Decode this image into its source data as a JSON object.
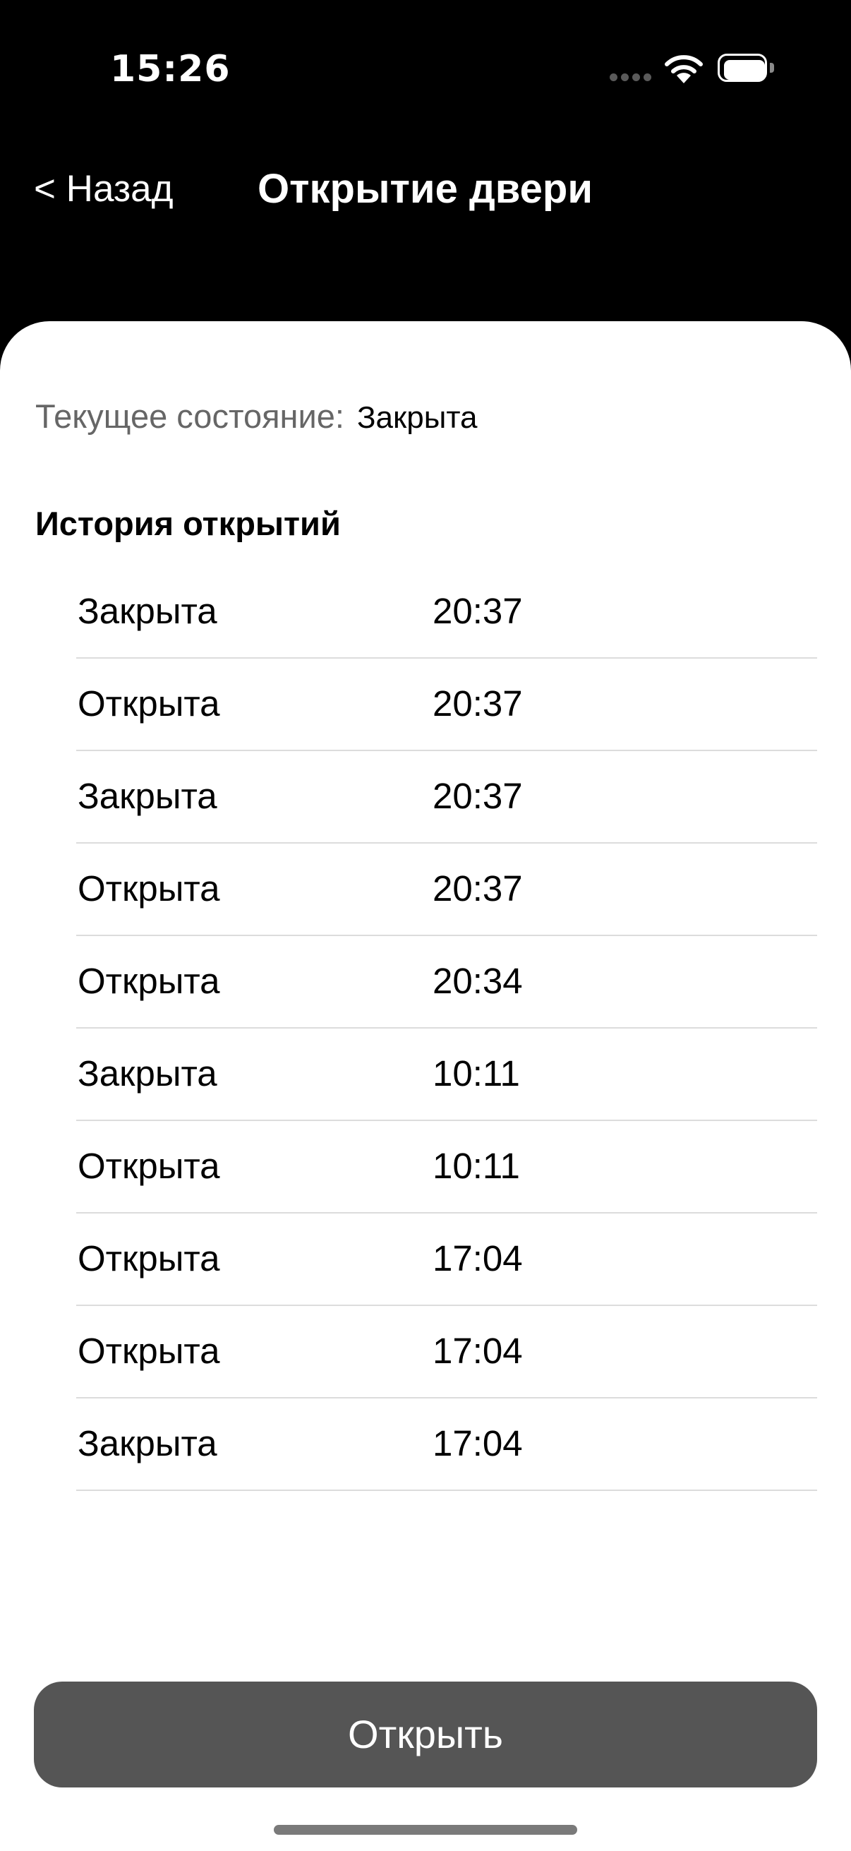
{
  "status_bar": {
    "time": "15:26",
    "signal_icon": "signal-dots-icon",
    "wifi_icon": "wifi-icon",
    "battery_icon": "battery-icon",
    "battery_level": 1.0
  },
  "nav": {
    "back_label": "< Назад",
    "title": "Открытие двери"
  },
  "current_state": {
    "label": "Текущее состояние:",
    "value": "Закрыта"
  },
  "history": {
    "title": "История открытий",
    "rows": [
      {
        "state": "Закрыта",
        "time": "20:37"
      },
      {
        "state": "Открыта",
        "time": "20:37"
      },
      {
        "state": "Закрыта",
        "time": "20:37"
      },
      {
        "state": "Открыта",
        "time": "20:37"
      },
      {
        "state": "Открыта",
        "time": "20:34"
      },
      {
        "state": "Закрыта",
        "time": "10:11"
      },
      {
        "state": "Открыта",
        "time": "10:11"
      },
      {
        "state": "Открыта",
        "time": "17:04"
      },
      {
        "state": "Открыта",
        "time": "17:04"
      },
      {
        "state": "Закрыта",
        "time": "17:04"
      }
    ]
  },
  "actions": {
    "open_label": "Открыть"
  },
  "colors": {
    "background": "#000000",
    "sheet": "#ffffff",
    "button": "#555555",
    "separator": "#dcdcdc",
    "secondary_text": "#666666"
  }
}
